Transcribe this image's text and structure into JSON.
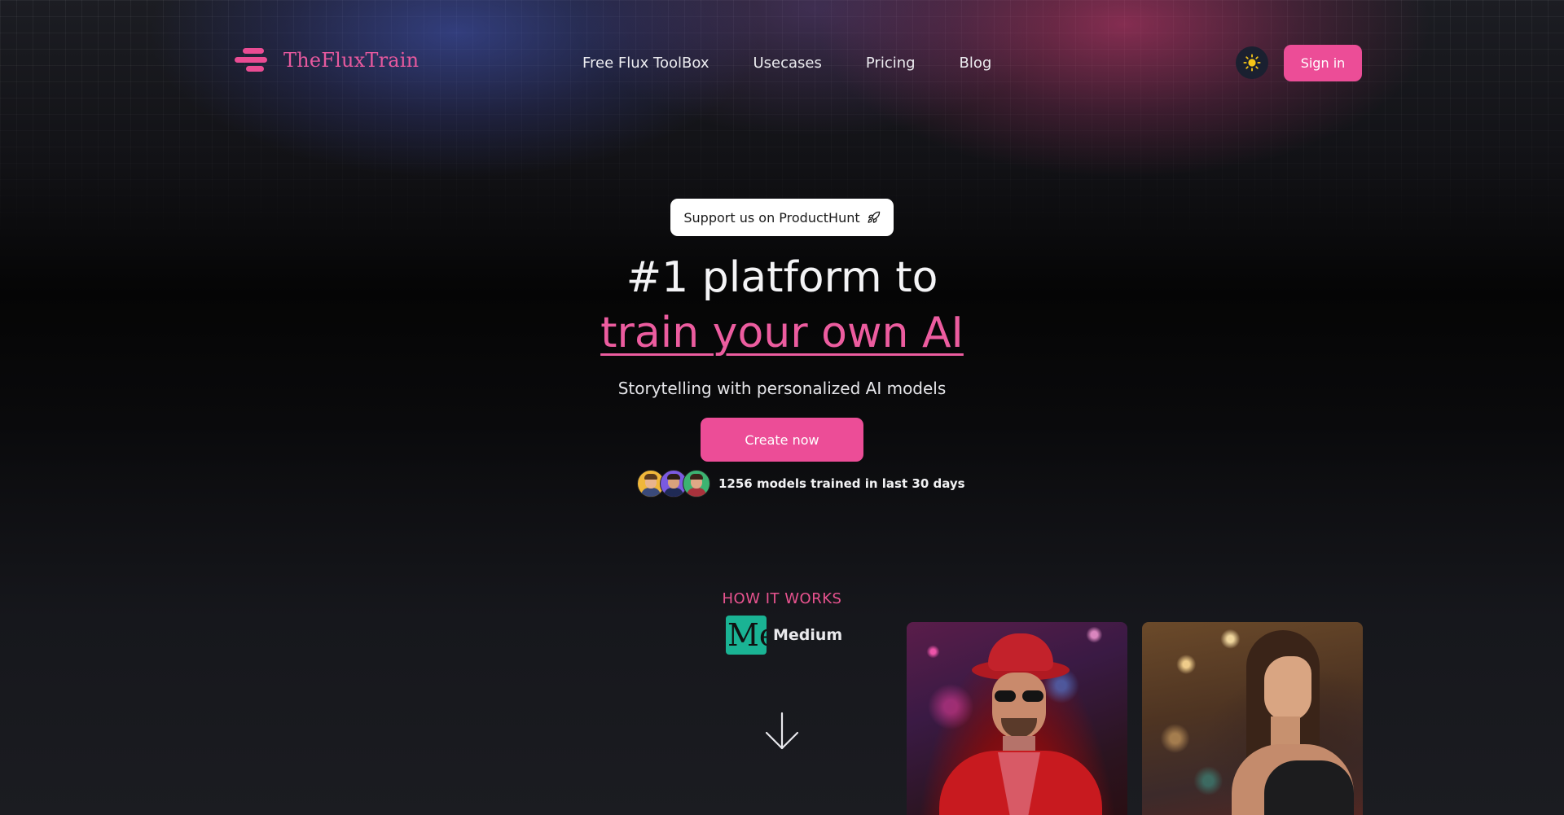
{
  "brand": {
    "name": "TheFluxTrain",
    "logo_icon": "menu-lines-icon",
    "accent_color": "#ec4d97"
  },
  "nav": {
    "items": [
      {
        "label": "Free Flux ToolBox"
      },
      {
        "label": "Usecases"
      },
      {
        "label": "Pricing"
      },
      {
        "label": "Blog"
      }
    ],
    "theme_toggle_icon": "sun-icon",
    "signin_label": "Sign in"
  },
  "hero": {
    "producthunt_label": "Support us on ProductHunt",
    "producthunt_icon": "rocket-icon",
    "title_line1": "#1 platform to",
    "title_line2": "train your own AI",
    "subtitle": "Storytelling with personalized AI models",
    "cta_label": "Create now",
    "social_proof": "1256 models trained in last 30 days"
  },
  "how_it_works": {
    "label": "HOW IT WORKS",
    "medium_logo_text": "Mе",
    "medium_label": "Medium",
    "arrow_icon": "arrow-down-icon"
  },
  "showcase": {
    "images": [
      {
        "name": "man-in-red-suit-photo"
      },
      {
        "name": "woman-in-casino-photo"
      }
    ]
  }
}
